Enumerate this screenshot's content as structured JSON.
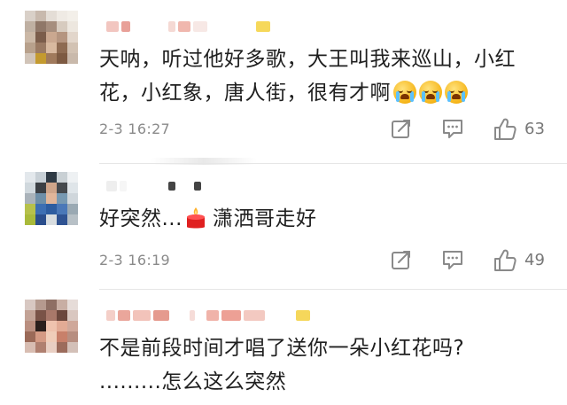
{
  "comments": [
    {
      "text": "天呐，听过他好多歌，大王叫我来巡山，小红花，小红象，唐人街，很有才啊",
      "time": "2-3 16:27",
      "like_count": "63",
      "emoji_icons": [
        "crying-face-icon",
        "crying-face-icon",
        "crying-face-icon"
      ]
    },
    {
      "text_before": "好突然...",
      "text_after": "潇洒哥走好",
      "time": "2-3 16:19",
      "like_count": "49",
      "emoji_icons": [
        "candle-icon"
      ]
    },
    {
      "text": "不是前段时间才唱了送你一朵小红花吗?\n.........怎么这么突然"
    }
  ],
  "icons": {
    "share": "share-icon",
    "reply": "reply-icon",
    "like": "thumbs-up-icon"
  },
  "colors": {
    "text": "#1f1f1f",
    "meta": "#8a8a8a",
    "divider": "#e6e6e6",
    "emoji": "#f5b418",
    "candle": "#e02020"
  }
}
